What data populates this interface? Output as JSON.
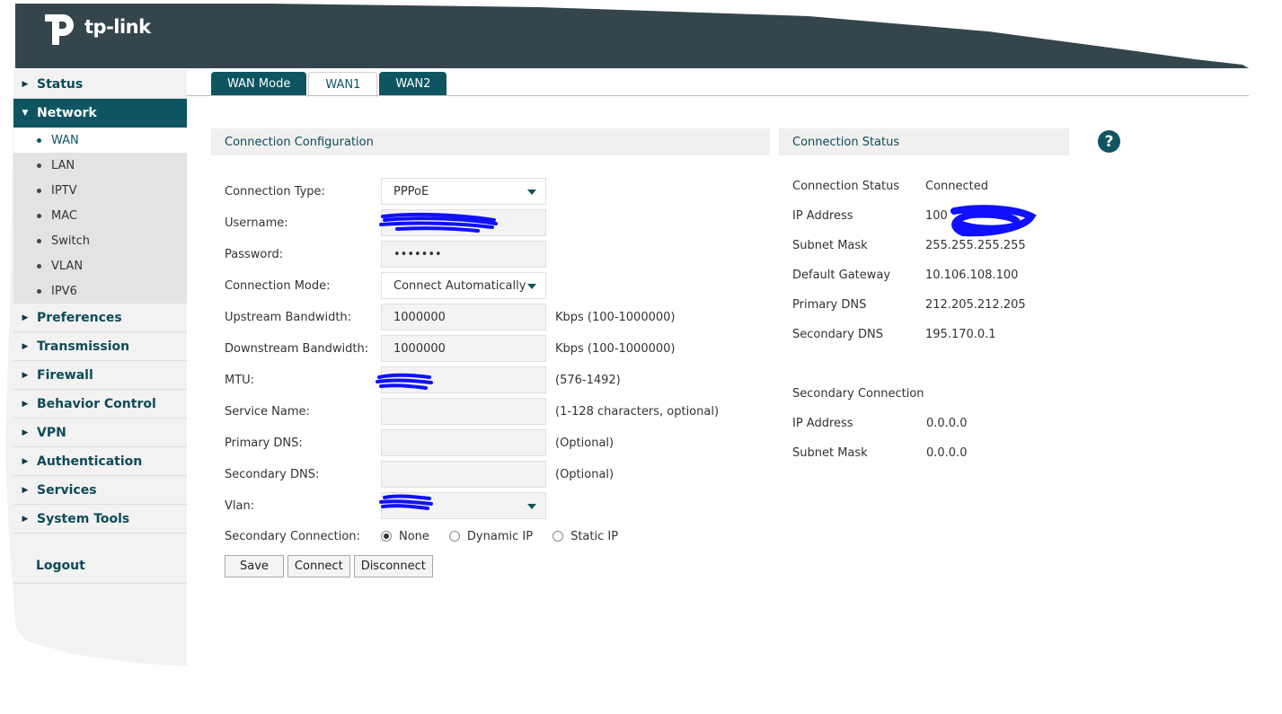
{
  "brand": {
    "logo_text": "tp-link"
  },
  "sidebar": {
    "items": [
      {
        "label": "Status"
      },
      {
        "label": "Network"
      },
      {
        "label": "Preferences"
      },
      {
        "label": "Transmission"
      },
      {
        "label": "Firewall"
      },
      {
        "label": "Behavior Control"
      },
      {
        "label": "VPN"
      },
      {
        "label": "Authentication"
      },
      {
        "label": "Services"
      },
      {
        "label": "System Tools"
      }
    ],
    "network_sub": [
      "WAN",
      "LAN",
      "IPTV",
      "MAC",
      "Switch",
      "VLAN",
      "IPV6"
    ],
    "logout": "Logout"
  },
  "tabs": [
    "WAN Mode",
    "WAN1",
    "WAN2"
  ],
  "config": {
    "title": "Connection Configuration",
    "connection_type_label": "Connection Type:",
    "connection_type_value": "PPPoE",
    "username_label": "Username:",
    "password_label": "Password:",
    "password_value": "•••••••",
    "connection_mode_label": "Connection Mode:",
    "connection_mode_value": "Connect Automatically",
    "upstream_label": "Upstream Bandwidth:",
    "upstream_value": "1000000",
    "upstream_hint": "Kbps (100-1000000)",
    "downstream_label": "Downstream Bandwidth:",
    "downstream_value": "1000000",
    "downstream_hint": "Kbps (100-1000000)",
    "mtu_label": "MTU:",
    "mtu_hint": "(576-1492)",
    "service_name_label": "Service Name:",
    "service_name_hint": "(1-128 characters, optional)",
    "primary_dns_label": "Primary DNS:",
    "primary_dns_hint": "(Optional)",
    "secondary_dns_label": "Secondary DNS:",
    "secondary_dns_hint": "(Optional)",
    "vlan_label": "Vlan:",
    "secondary_connection_label": "Secondary Connection:",
    "secondary_options": [
      "None",
      "Dynamic IP",
      "Static IP"
    ],
    "buttons": {
      "save": "Save",
      "connect": "Connect",
      "disconnect": "Disconnect"
    }
  },
  "status": {
    "title": "Connection Status",
    "rows": [
      {
        "label": "Connection Status",
        "value": "Connected"
      },
      {
        "label": "IP Address",
        "value": "100"
      },
      {
        "label": "Subnet Mask",
        "value": "255.255.255.255"
      },
      {
        "label": "Default Gateway",
        "value": "10.106.108.100"
      },
      {
        "label": "Primary DNS",
        "value": "212.205.212.205"
      },
      {
        "label": "Secondary DNS",
        "value": "195.170.0.1"
      }
    ],
    "secondary_title": "Secondary Connection",
    "secondary_rows": [
      {
        "label": "IP Address",
        "value": "0.0.0.0"
      },
      {
        "label": "Subnet Mask",
        "value": "0.0.0.0"
      }
    ]
  },
  "help_icon": "?",
  "colors": {
    "header": "#35454c",
    "accent": "#0e5561",
    "redaction": "#1010ff"
  }
}
